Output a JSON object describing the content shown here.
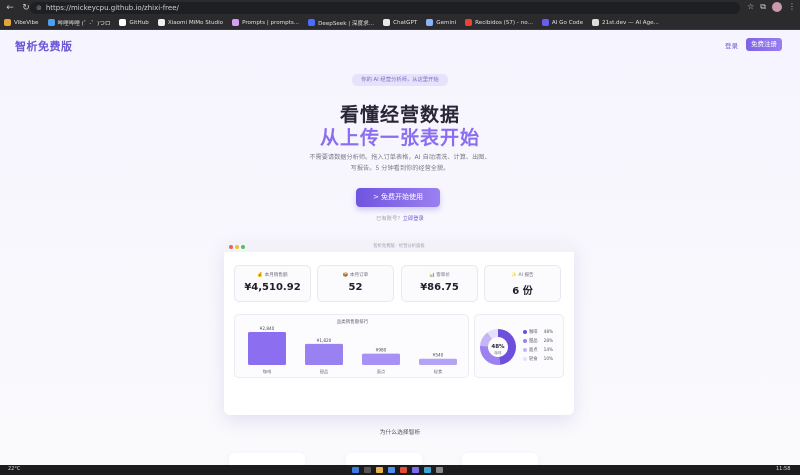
{
  "browser": {
    "url": "https://mickeycpu.github.io/zhixi-free/",
    "bookmarks": [
      {
        "label": "VibeVibe",
        "color": "#e3a43b"
      },
      {
        "label": "哔哩哔哩 (゜-゜)つロ",
        "color": "#4f9ff0"
      },
      {
        "label": "GitHub",
        "color": "#ffffff"
      },
      {
        "label": "Xiaomi MiMo Studio",
        "color": "#f0f0f0"
      },
      {
        "label": "Prompts | prompts...",
        "color": "#d3a0f0"
      },
      {
        "label": "DeepSeek | 深度求...",
        "color": "#4d6bfe"
      },
      {
        "label": "ChatGPT",
        "color": "#e9e9e9"
      },
      {
        "label": "Gemini",
        "color": "#8ab4f8"
      },
      {
        "label": "Recibidos (57) - no...",
        "color": "#ea4335"
      },
      {
        "label": "AI Go Code",
        "color": "#6a5cf0"
      },
      {
        "label": "21st.dev — AI Age...",
        "color": "#dddddd"
      }
    ]
  },
  "site": {
    "logo": "智析免费版",
    "login": "登录",
    "signup": "免费注册"
  },
  "hero": {
    "pill": "你的 AI 经营分析师，从这里开始",
    "title_line1": "看懂经营数据",
    "title_line2": "从上传一张表开始",
    "subtitle_line1": "不需要请数据分析师。拖入订单表格，AI 自动清洗、计算、出图、",
    "subtitle_line2": "写报告。5 分钟看到你的经营全貌。",
    "cta": "> 免费开始使用",
    "already_prefix": "已有账号？",
    "already_link": "立即登录"
  },
  "dashboard": {
    "window_title": "智析免费版 · 经营分析面板",
    "stats": [
      {
        "label": "💰 本月销售额",
        "value": "¥4,510.92"
      },
      {
        "label": "📦 本月订单",
        "value": "52"
      },
      {
        "label": "📊 客单价",
        "value": "¥86.75"
      },
      {
        "label": "✨ AI 报告",
        "value": "6 份"
      }
    ]
  },
  "chart_data": [
    {
      "type": "bar",
      "title": "品类销售额排行",
      "categories": [
        "咖啡",
        "甜品",
        "面点",
        "轻食"
      ],
      "values": [
        2840,
        1820,
        980,
        540
      ],
      "value_labels": [
        "¥2,840",
        "¥1,820",
        "¥980",
        "¥540"
      ],
      "ylim": [
        0,
        3100
      ],
      "color": "#8b6ff0"
    },
    {
      "type": "pie",
      "center_value": "48%",
      "center_label": "咖啡",
      "categories": [
        "咖啡",
        "甜品",
        "面点",
        "轻食"
      ],
      "values": [
        48,
        28,
        14,
        10
      ],
      "value_labels": [
        "48%",
        "28%",
        "14%",
        "10%"
      ],
      "colors": [
        "#6d4fdc",
        "#9b82ef",
        "#c4b6f6",
        "#e6e0fb"
      ]
    }
  ],
  "sections": {
    "why_title": "为什么选择智析"
  },
  "taskbar": {
    "weather": "22°C",
    "time": "11:58"
  }
}
